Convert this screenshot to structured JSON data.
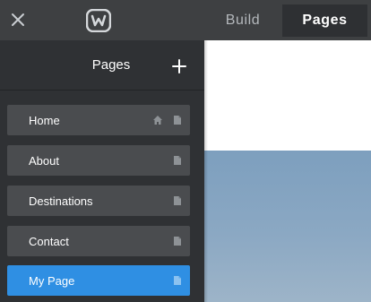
{
  "topbar": {
    "tabs": [
      {
        "label": "Build"
      },
      {
        "label": "Pages"
      }
    ],
    "active_tab": "Pages",
    "logo_icon": "weebly-logo-icon",
    "close_icon": "close-icon"
  },
  "sidebar": {
    "title": "Pages",
    "add_icon": "plus-icon",
    "pages": [
      {
        "label": "Home",
        "is_home": true,
        "selected": false
      },
      {
        "label": "About",
        "is_home": false,
        "selected": false
      },
      {
        "label": "Destinations",
        "is_home": false,
        "selected": false
      },
      {
        "label": "Contact",
        "is_home": false,
        "selected": false
      },
      {
        "label": "My Page",
        "is_home": false,
        "selected": true
      }
    ]
  },
  "colors": {
    "topbar": "#3e4042",
    "sidebar": "#2f3134",
    "item": "#4a4c4f",
    "selected": "#2f8fe3"
  }
}
